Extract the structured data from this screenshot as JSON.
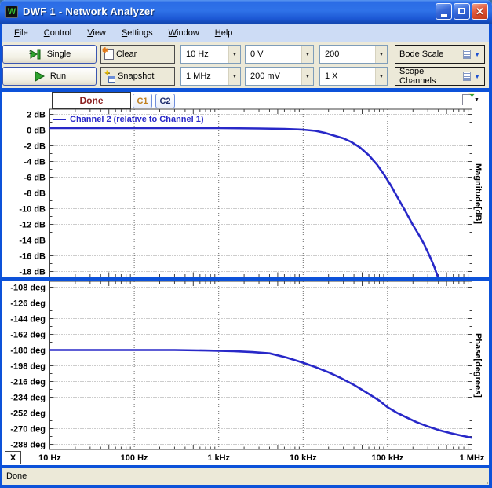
{
  "window": {
    "title": "DWF 1 - Network Analyzer"
  },
  "menu": {
    "items": [
      "File",
      "Control",
      "View",
      "Settings",
      "Window",
      "Help"
    ]
  },
  "toolbar": {
    "single_label": "Single",
    "run_label": "Run",
    "clear_label": "Clear",
    "snapshot_label": "Snapshot",
    "start_frequency": "10 Hz",
    "stop_frequency": "1 MHz",
    "offset": "0 V",
    "amplitude": "200 mV",
    "samples": "200",
    "gain": "1 X",
    "bode_scale_label": "Bode Scale",
    "scope_channels_label": "Scope Channels"
  },
  "plot_header": {
    "status": "Done",
    "channel1": "C1",
    "channel2": "C2"
  },
  "plot_footer": {
    "close_button": "X"
  },
  "status_bar": {
    "text": "Done"
  },
  "icons": {
    "app": "waveforms-logo",
    "minimize": "–",
    "maximize": "▢",
    "close": "✕",
    "single": "step-once-arrow",
    "run": "green-play-triangle",
    "clear": "page-with-spark",
    "snapshot": "window-with-plus",
    "combo_arrow": "▼",
    "panel_list": "list-lines",
    "export": "page-with-arrow",
    "resize": "grip-dots"
  },
  "colors": {
    "window_border": "#0d52d9",
    "titlebar": "#2b6ce6",
    "toolbar_bg": "#ece9d8",
    "menubar_bg": "#cddcf5",
    "curve": "#2828c8",
    "status_done_text": "#8b1f1f",
    "c1_text": "#c08020",
    "c2_text": "#1f2d6e",
    "grid": "#9a9a9a"
  },
  "chart_data": [
    {
      "type": "line",
      "name": "magnitude",
      "ylabel": "Magnitude[dB]",
      "legend": "Channel 2 (relative to Channel 1)",
      "yunit": "dB",
      "xscale": "log",
      "grid": true,
      "legend_position": "top-left",
      "yticks": [
        2,
        0,
        -2,
        -4,
        -6,
        -8,
        -10,
        -12,
        -14,
        -16,
        -18
      ],
      "ytick_labels": [
        "2 dB",
        "0 dB",
        "-2 dB",
        "-4 dB",
        "-6 dB",
        "-8 dB",
        "-10 dB",
        "-12 dB",
        "-14 dB",
        "-16 dB",
        "-18 dB"
      ],
      "xticks": {
        "hz": [
          10,
          100,
          1000,
          10000,
          100000,
          1000000
        ],
        "labels": [
          "10 Hz",
          "100 Hz",
          "1 kHz",
          "10 kHz",
          "100 kHz",
          "1 MHz"
        ]
      },
      "series": [
        {
          "name": "Channel 2 (relative to Channel 1)",
          "color": "#2828c8",
          "points": [
            [
              10,
              0.25
            ],
            [
              100,
              0.25
            ],
            [
              1000,
              0.25
            ],
            [
              3000,
              0.2
            ],
            [
              6000,
              0.15
            ],
            [
              10000,
              0.05
            ],
            [
              14000,
              -0.1
            ],
            [
              18000,
              -0.35
            ],
            [
              24000,
              -0.75
            ],
            [
              30000,
              -1.05
            ],
            [
              37000,
              -1.5
            ],
            [
              47000,
              -2.2
            ],
            [
              60000,
              -3.2
            ],
            [
              75000,
              -4.4
            ],
            [
              90000,
              -5.6
            ],
            [
              110000,
              -7.1
            ],
            [
              130000,
              -8.5
            ],
            [
              160000,
              -10.2
            ],
            [
              200000,
              -12.1
            ],
            [
              240000,
              -13.5
            ],
            [
              270000,
              -14.5
            ],
            [
              320000,
              -16.2
            ],
            [
              360000,
              -17.5
            ],
            [
              400000,
              -18.9
            ],
            [
              430000,
              -19.6
            ]
          ]
        }
      ]
    },
    {
      "type": "line",
      "name": "phase",
      "ylabel": "Phase[degrees]",
      "yunit": "deg",
      "xscale": "log",
      "grid": true,
      "yticks": [
        -108,
        -126,
        -144,
        -162,
        -180,
        -198,
        -216,
        -234,
        -252,
        -270,
        -288
      ],
      "ytick_labels": [
        "-108 deg",
        "-126 deg",
        "-144 deg",
        "-162 deg",
        "-180 deg",
        "-198 deg",
        "-216 deg",
        "-234 deg",
        "-252 deg",
        "-270 deg",
        "-288 deg"
      ],
      "xticks": {
        "hz": [
          10,
          100,
          1000,
          10000,
          100000,
          1000000
        ],
        "labels": [
          "10 Hz",
          "100 Hz",
          "1 kHz",
          "10 kHz",
          "100 kHz",
          "1 MHz"
        ]
      },
      "series": [
        {
          "name": "Channel 2 (relative to Channel 1)",
          "color": "#2828c8",
          "points": [
            [
              10,
              -180
            ],
            [
              300,
              -180
            ],
            [
              700,
              -180.5
            ],
            [
              1500,
              -181.3
            ],
            [
              2500,
              -182.3
            ],
            [
              4000,
              -183.8
            ],
            [
              6300,
              -188.5
            ],
            [
              10000,
              -194.5
            ],
            [
              14000,
              -199.5
            ],
            [
              20000,
              -205.5
            ],
            [
              28000,
              -212
            ],
            [
              40000,
              -220
            ],
            [
              56000,
              -228.5
            ],
            [
              80000,
              -238
            ],
            [
              100000,
              -245.5
            ],
            [
              130000,
              -252
            ],
            [
              170000,
              -257.5
            ],
            [
              220000,
              -262.5
            ],
            [
              300000,
              -267.5
            ],
            [
              400000,
              -271.5
            ],
            [
              550000,
              -275
            ],
            [
              750000,
              -278
            ],
            [
              1000000,
              -280.5
            ]
          ]
        }
      ]
    }
  ]
}
